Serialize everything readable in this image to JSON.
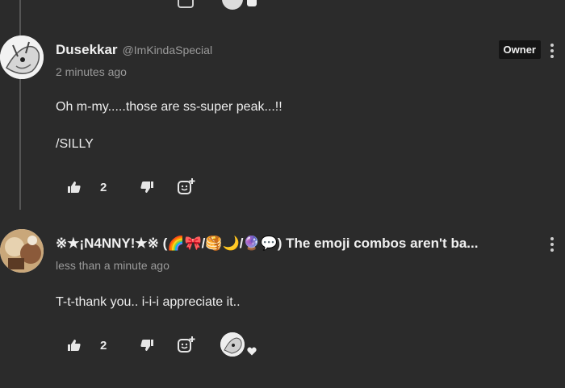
{
  "comments": [
    {
      "author": "Dusekkar",
      "handle": "@ImKindaSpecial",
      "badge": "Owner",
      "time": "2 minutes ago",
      "lines": [
        "Oh m-my.....those are ss-super peak...!!",
        "/SILLY"
      ],
      "likes": "2"
    },
    {
      "author": "※★¡N4NNY!★※ (🌈🎀/🥞🌙/🔮💬) The emoji combos aren't ba...",
      "time": "less than a minute ago",
      "lines": [
        "T-t-thank you.. i-i-i appreciate it.."
      ],
      "likes": "2"
    }
  ],
  "icons": {
    "like": "thumbs-up-icon",
    "dislike": "thumbs-down-icon",
    "react": "add-reaction-icon",
    "menu": "more-vertical-icon",
    "heart": "heart-icon"
  },
  "colors": {
    "background": "#2b2b2b",
    "text": "#ececec",
    "muted": "#9a9a9a",
    "badge_bg": "#151515"
  }
}
